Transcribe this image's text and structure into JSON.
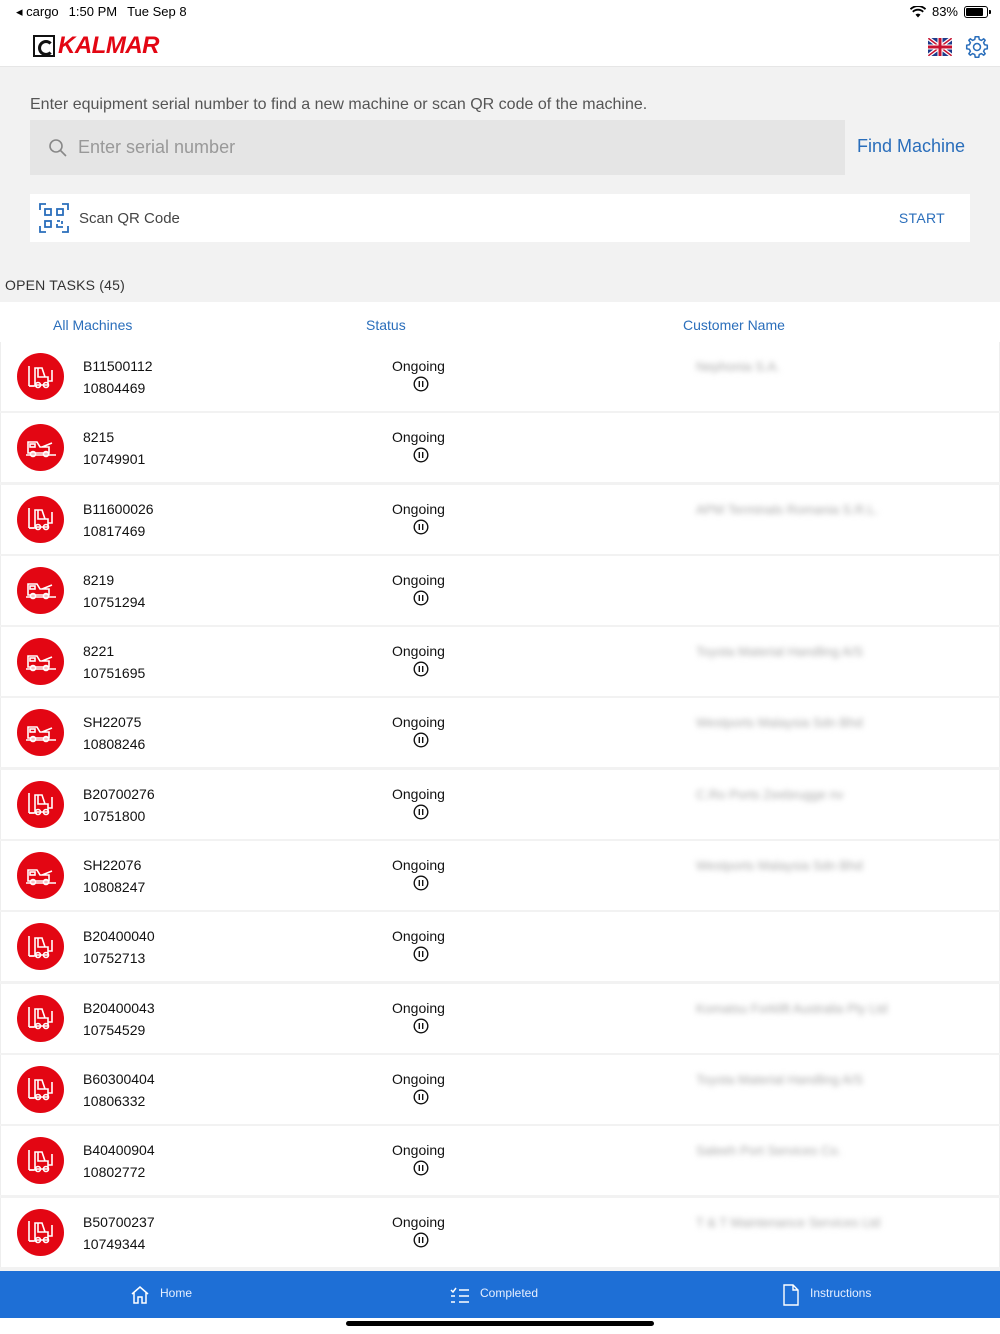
{
  "statusbar": {
    "back_app": "cargo",
    "time": "1:50 PM",
    "date": "Tue Sep 8",
    "battery": "83%",
    "battery_level": 0.83
  },
  "header": {
    "logo_text": "KALMAR"
  },
  "search": {
    "hint": "Enter equipment serial number to find a new machine or scan QR code of the machine.",
    "placeholder": "Enter serial number",
    "find_label": "Find Machine"
  },
  "qr": {
    "label": "Scan QR Code",
    "start_label": "START"
  },
  "tasks": {
    "open_label": "OPEN TASKS (45)",
    "columns": {
      "machines": "All Machines",
      "status": "Status",
      "customer": "Customer Name"
    },
    "rows": [
      {
        "serial": "B11500112",
        "number": "10804469",
        "status": "Ongoing",
        "customer": "Nephonia S.A.",
        "icon": "forklift-icon"
      },
      {
        "serial": "8215",
        "number": "10749901",
        "status": "Ongoing",
        "customer": "",
        "icon": "terminal-tractor-icon"
      },
      {
        "serial": "B11600026",
        "number": "10817469",
        "status": "Ongoing",
        "customer": "APM Terminals Romania S.R.L.",
        "icon": "forklift-icon"
      },
      {
        "serial": "8219",
        "number": "10751294",
        "status": "Ongoing",
        "customer": "",
        "icon": "terminal-tractor-icon"
      },
      {
        "serial": "8221",
        "number": "10751695",
        "status": "Ongoing",
        "customer": "Toyota Material Handling A/S",
        "icon": "terminal-tractor-icon"
      },
      {
        "serial": "SH22075",
        "number": "10808246",
        "status": "Ongoing",
        "customer": "Westports Malaysia Sdn Bhd",
        "icon": "terminal-tractor-icon"
      },
      {
        "serial": "B20700276",
        "number": "10751800",
        "status": "Ongoing",
        "customer": "C.Ro Ports Zeebrugge nv",
        "icon": "forklift-icon"
      },
      {
        "serial": "SH22076",
        "number": "10808247",
        "status": "Ongoing",
        "customer": "Westports Malaysia Sdn Bhd",
        "icon": "terminal-tractor-icon"
      },
      {
        "serial": "B20400040",
        "number": "10752713",
        "status": "Ongoing",
        "customer": "",
        "icon": "forklift-icon"
      },
      {
        "serial": "B20400043",
        "number": "10754529",
        "status": "Ongoing",
        "customer": "Komatsu Forklift Australia Pty Ltd",
        "icon": "forklift-icon"
      },
      {
        "serial": "B60300404",
        "number": "10806332",
        "status": "Ongoing",
        "customer": "Toyota Material Handling A/S",
        "icon": "forklift-icon"
      },
      {
        "serial": "B40400904",
        "number": "10802772",
        "status": "Ongoing",
        "customer": "Saleeh Port Services Co.",
        "icon": "forklift-icon"
      },
      {
        "serial": "B50700237",
        "number": "10749344",
        "status": "Ongoing",
        "customer": "T & T Maintenance Services Ltd",
        "icon": "forklift-icon"
      }
    ]
  },
  "tabbar": {
    "home": "Home",
    "completed": "Completed",
    "instructions": "Instructions"
  },
  "colors": {
    "accent": "#2a6ebb",
    "brand_red": "#e30613",
    "tabbar": "#1e6fd6"
  }
}
